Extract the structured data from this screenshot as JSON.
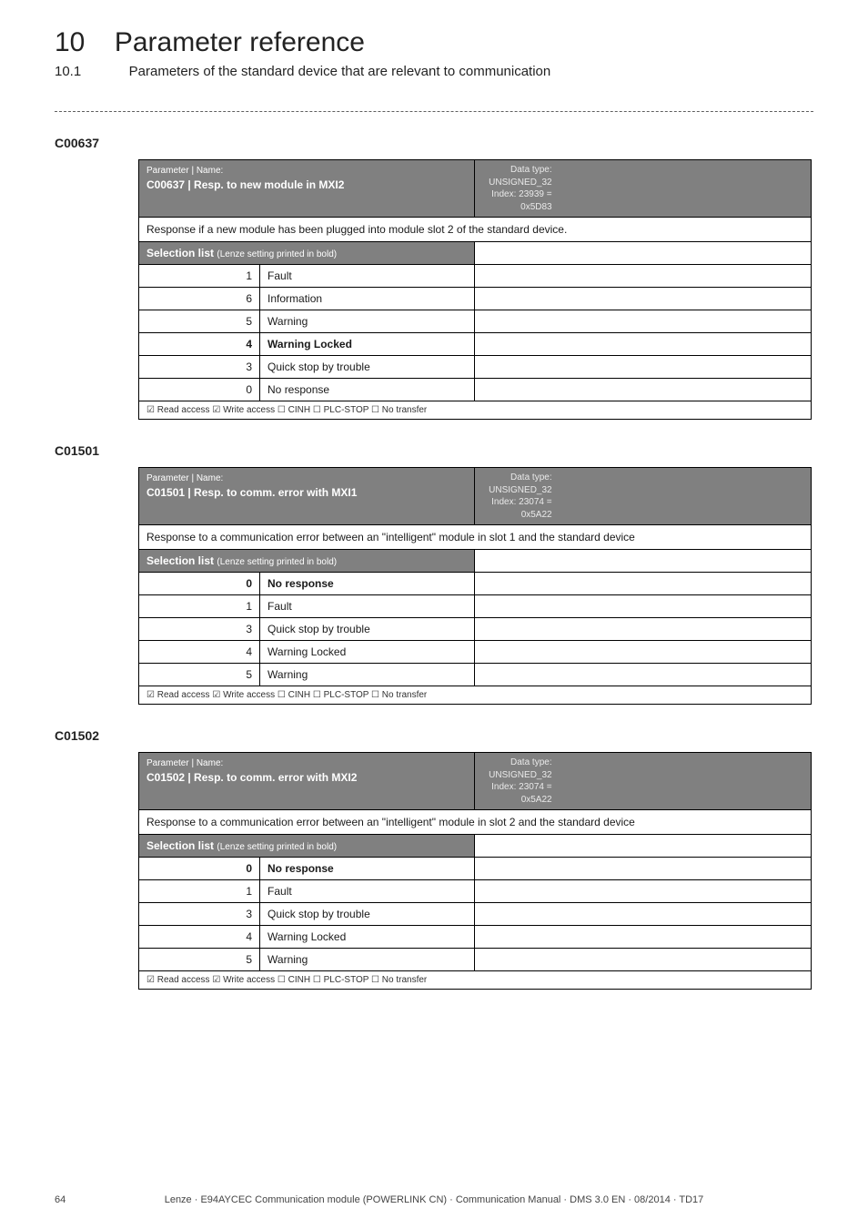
{
  "chapter": {
    "num": "10",
    "title": "Parameter reference"
  },
  "subsection": {
    "num": "10.1",
    "title": "Parameters of the standard device that are relevant to communication"
  },
  "common": {
    "pn_label": "Parameter | Name:",
    "sel_header": "Selection list",
    "sel_header_sub": "(Lenze setting printed in bold)",
    "flags": "☑ Read access   ☑ Write access   ☐ CINH   ☐ PLC-STOP   ☐ No transfer"
  },
  "params": [
    {
      "code": "C00637",
      "name": "C00637 | Resp. to new module in MXI2",
      "dtype": "Data type: UNSIGNED_32",
      "index": "Index: 23939 = 0x5D83",
      "desc": "Response if a new module has been plugged into module slot 2 of the standard device.",
      "rows": [
        {
          "n": "1",
          "v": "Fault",
          "bold": false
        },
        {
          "n": "6",
          "v": "Information",
          "bold": false
        },
        {
          "n": "5",
          "v": "Warning",
          "bold": false
        },
        {
          "n": "4",
          "v": "Warning Locked",
          "bold": true
        },
        {
          "n": "3",
          "v": "Quick stop by trouble",
          "bold": false
        },
        {
          "n": "0",
          "v": "No response",
          "bold": false
        }
      ]
    },
    {
      "code": "C01501",
      "name": "C01501 | Resp. to comm. error with MXI1",
      "dtype": "Data type: UNSIGNED_32",
      "index": "Index: 23074 = 0x5A22",
      "desc": "Response to a communication error between an \"intelligent\" module in slot 1 and the standard device",
      "rows": [
        {
          "n": "0",
          "v": "No response",
          "bold": true
        },
        {
          "n": "1",
          "v": "Fault",
          "bold": false
        },
        {
          "n": "3",
          "v": "Quick stop by trouble",
          "bold": false
        },
        {
          "n": "4",
          "v": "Warning Locked",
          "bold": false
        },
        {
          "n": "5",
          "v": "Warning",
          "bold": false
        }
      ]
    },
    {
      "code": "C01502",
      "name": "C01502 | Resp. to comm. error with MXI2",
      "dtype": "Data type: UNSIGNED_32",
      "index": "Index: 23074 = 0x5A22",
      "desc": "Response to a communication error between an \"intelligent\" module in slot 2 and the standard device",
      "rows": [
        {
          "n": "0",
          "v": "No response",
          "bold": true
        },
        {
          "n": "1",
          "v": "Fault",
          "bold": false
        },
        {
          "n": "3",
          "v": "Quick stop by trouble",
          "bold": false
        },
        {
          "n": "4",
          "v": "Warning Locked",
          "bold": false
        },
        {
          "n": "5",
          "v": "Warning",
          "bold": false
        }
      ]
    }
  ],
  "footer": {
    "page": "64",
    "doc": "Lenze · E94AYCEC Communication module (POWERLINK CN) · Communication Manual · DMS 3.0 EN · 08/2014 · TD17"
  }
}
